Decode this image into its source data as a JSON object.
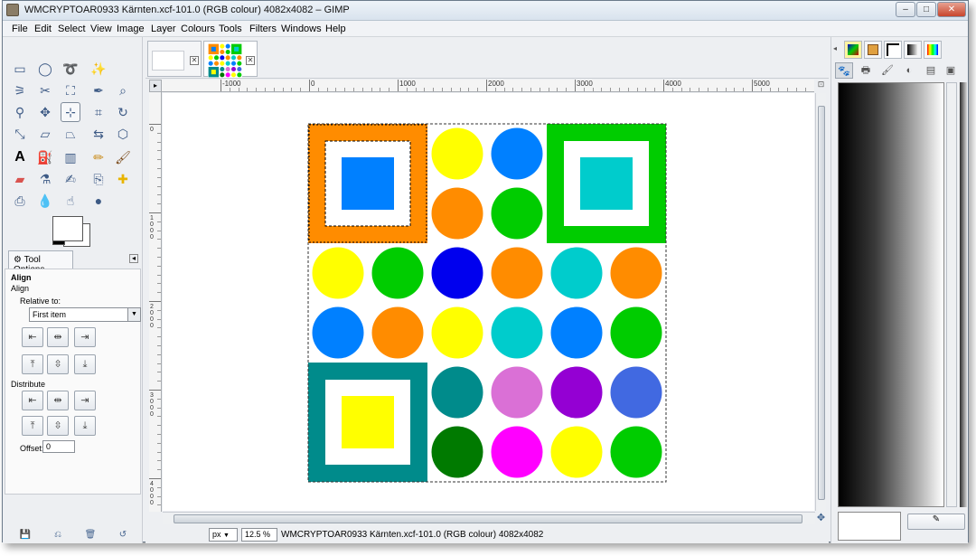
{
  "window": {
    "title": "WMCRYPTOAR0933 Kärnten.xcf-101.0 (RGB colour) 4082x4082 – GIMP",
    "minimize": "–",
    "maximize": "□",
    "close": "✕"
  },
  "menu": [
    "File",
    "Edit",
    "Select",
    "View",
    "Image",
    "Layer",
    "Colours",
    "Tools",
    "Filters",
    "Windows",
    "Help"
  ],
  "tool_options": {
    "tab_label": "Tool Options",
    "tool_name": "Align",
    "section_align": "Align",
    "relative_to_label": "Relative to:",
    "relative_to_value": "First item",
    "distribute_label": "Distribute",
    "offset_label": "Offset:",
    "offset_value": "0"
  },
  "rulers": {
    "top": [
      "-1000",
      "0",
      "1000",
      "2000",
      "3000",
      "4000",
      "5000"
    ],
    "left": [
      "0",
      "1000",
      "2000",
      "3000",
      "4000"
    ]
  },
  "status": {
    "unit": "px",
    "zoom": "12.5 %",
    "text": "WMCRYPTOAR0933 Kärnten.xcf-101.0 (RGB colour) 4082x4082"
  },
  "colors": {
    "orange": "#ff8c00",
    "blue": "#0080ff",
    "green": "#00cc00",
    "cyan": "#00cccc",
    "yellow": "#ffff00",
    "teal": "#008b8b",
    "darkblue": "#0000ee",
    "orchid": "#da70d6",
    "purple": "#9400d3",
    "royalblue": "#4169e1",
    "darkgreen": "#007a00",
    "magenta": "#ff00ff"
  },
  "image": {
    "grid": [
      [
        "square:orange:blue",
        null,
        "yellow",
        "blue",
        "square:green:cyan",
        null
      ],
      [
        null,
        null,
        "orange",
        "green",
        null,
        null
      ],
      [
        "yellow",
        "green",
        "darkblue",
        "orange",
        "cyan",
        "orange"
      ],
      [
        "blue",
        "orange",
        "yellow",
        "cyan",
        "blue",
        "green"
      ],
      [
        "square:teal:yellow",
        null,
        "teal",
        "orchid",
        "purple",
        "royalblue"
      ],
      [
        null,
        null,
        "darkgreen",
        "magenta",
        "yellow",
        "green"
      ]
    ]
  }
}
